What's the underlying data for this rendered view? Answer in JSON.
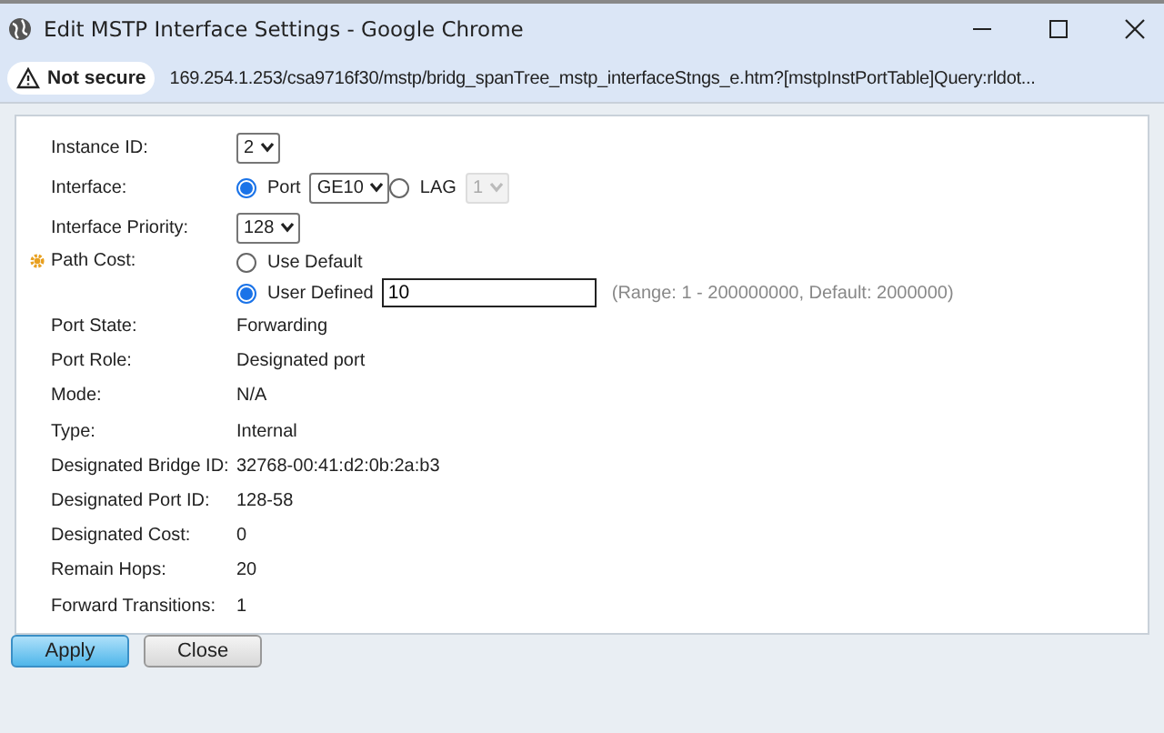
{
  "window": {
    "title": "Edit MSTP Interface Settings - Google Chrome"
  },
  "address_bar": {
    "security_label": "Not secure",
    "url": "169.254.1.253/csa9716f30/mstp/bridg_spanTree_mstp_interfaceStngs_e.htm?[mstpInstPortTable]Query:rldot..."
  },
  "instance_id": {
    "label": "Instance ID:",
    "value": "2"
  },
  "interface": {
    "label": "Interface:",
    "options": [
      {
        "label": "Port",
        "selected": true,
        "value": "GE10",
        "disabled": false
      },
      {
        "label": "LAG",
        "selected": false,
        "value": "1",
        "disabled": true
      }
    ]
  },
  "priority": {
    "label": "Interface Priority:",
    "value": "128"
  },
  "path_cost": {
    "label": "Path Cost:",
    "options": [
      {
        "kind": "plain",
        "label": "Use Default",
        "selected": false
      },
      {
        "kind": "field",
        "label": "User Defined",
        "selected": true,
        "value": "10",
        "hint": "(Range: 1 - 200000000, Default: 2000000)"
      }
    ]
  },
  "details": [
    {
      "label": "Port State:",
      "value": "Forwarding"
    },
    {
      "label": "Port Role:",
      "value": "Designated port"
    },
    {
      "label": "Mode:",
      "value": "N/A"
    },
    {
      "label": "Type:",
      "value": "Internal"
    },
    {
      "label": "Designated Bridge ID:",
      "value": "32768-00:41:d2:0b:2a:b3"
    },
    {
      "label": "Designated Port ID:",
      "value": "128-58"
    },
    {
      "label": "Designated Cost:",
      "value": "0"
    },
    {
      "label": "Remain Hops:",
      "value": "20"
    },
    {
      "label": "Forward Transitions:",
      "value": "1"
    }
  ],
  "buttons": [
    {
      "label": "Apply",
      "kind": "primary"
    },
    {
      "label": "Close",
      "kind": "secondary"
    }
  ]
}
